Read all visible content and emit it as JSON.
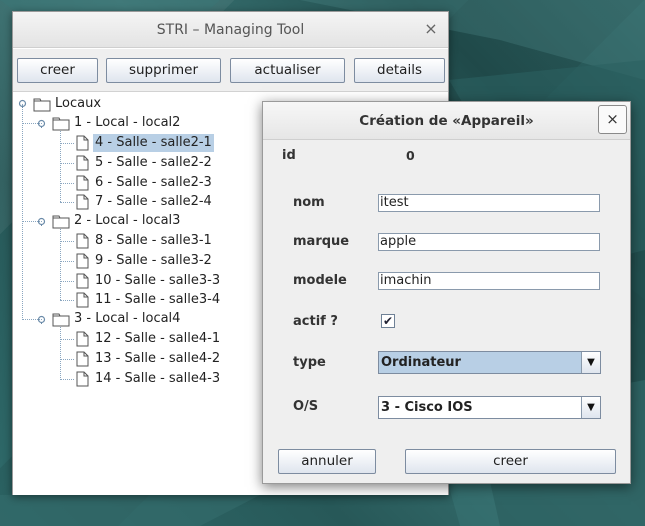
{
  "main_window": {
    "title": "STRI – Managing Tool",
    "close_glyph": "×",
    "toolbar": [
      {
        "label": "creer"
      },
      {
        "label": "supprimer"
      },
      {
        "label": "actualiser"
      },
      {
        "label": "details"
      }
    ]
  },
  "tree": {
    "root": {
      "label": "Locaux"
    },
    "groups": [
      {
        "label": "1 - Local - local2",
        "items": [
          "4 - Salle - salle2-1",
          "5 - Salle - salle2-2",
          "6 - Salle - salle2-3",
          "7 - Salle - salle2-4"
        ]
      },
      {
        "label": "2 - Local - local3",
        "items": [
          "8 - Salle - salle3-1",
          "9 - Salle - salle3-2",
          "10 - Salle - salle3-3",
          "11 - Salle - salle3-4"
        ]
      },
      {
        "label": "3 - Local - local4",
        "items": [
          "12 - Salle - salle4-1",
          "13 - Salle - salle4-2",
          "14 - Salle - salle4-3"
        ]
      }
    ],
    "selected": "4 - Salle - salle2-1"
  },
  "dialog": {
    "title": "Création de «Appareil»",
    "close_glyph": "×",
    "id_label": "id",
    "id_value": "0",
    "fields": {
      "nom": {
        "label": "nom",
        "value": "itest"
      },
      "marque": {
        "label": "marque",
        "value": "apple"
      },
      "modele": {
        "label": "modele",
        "value": "imachin"
      }
    },
    "actif": {
      "label": "actif ?",
      "checked": true,
      "check_glyph": "✔"
    },
    "type": {
      "label": "type",
      "selected": "Ordinateur",
      "arrow_glyph": "▼"
    },
    "os": {
      "label": "O/S",
      "selected": "3 - Cisco IOS",
      "arrow_glyph": "▼"
    },
    "buttons": {
      "cancel": "annuler",
      "create": "creer"
    }
  },
  "colors": {
    "selection": "#b8cfe5",
    "type_combo_bg": "#b8cfe5",
    "desktop": "#2a5a5a"
  },
  "icons": {
    "folder": "folder-icon",
    "file": "file-icon",
    "toggle": "tree-toggle-icon"
  }
}
